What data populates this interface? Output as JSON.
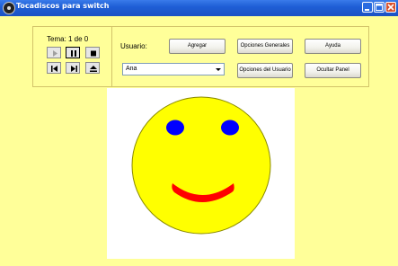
{
  "window": {
    "title": "Tocadiscos para switch"
  },
  "player": {
    "tema_label": "Tema: 1 de 0",
    "controls": [
      "play",
      "pause",
      "stop",
      "previous",
      "next",
      "eject"
    ]
  },
  "user": {
    "label": "Usuario:",
    "selected": "Ana"
  },
  "buttons": {
    "agregar": "Agregar",
    "opciones_generales": "Opciones Generales",
    "ayuda": "Ayuda",
    "opciones_usuario": "Opciones del Usuario",
    "ocultar_panel": "Ocultar Panel"
  },
  "colors": {
    "background": "#ffff99",
    "face": "#ffff00",
    "eyes": "#0000ff",
    "mouth": "#ff0000"
  }
}
